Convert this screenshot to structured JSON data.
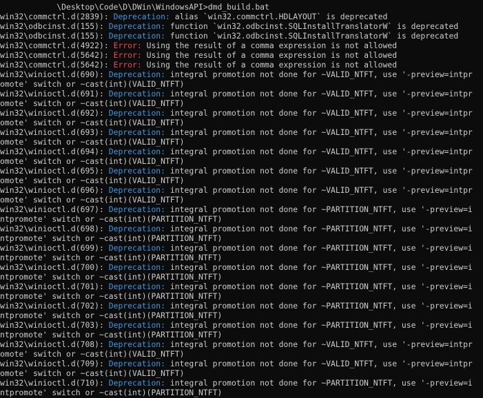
{
  "terminal": {
    "colors": {
      "background": "#0c0c0c",
      "default": "#cccccc",
      "info": "#3a96dd",
      "error": "#e74856"
    },
    "lines": [
      [
        {
          "t": "            \\Desktop\\Code\\D\\DWin\\WindowsAPI>dmd_build.bat",
          "c": "default"
        }
      ],
      [
        {
          "t": "win32\\commctrl.d(2839): ",
          "c": "default"
        },
        {
          "t": "Deprecation:",
          "c": "info"
        },
        {
          "t": " alias `win32.commctrl.HDLAYOUT` is deprecated",
          "c": "default"
        }
      ],
      [
        {
          "t": "win32\\odbcinst.d(155): ",
          "c": "default"
        },
        {
          "t": "Deprecation:",
          "c": "info"
        },
        {
          "t": " function `win32.odbcinst.SQLInstallTranslatorW` is deprecated",
          "c": "default"
        }
      ],
      [
        {
          "t": "win32\\odbcinst.d(155): ",
          "c": "default"
        },
        {
          "t": "Deprecation:",
          "c": "info"
        },
        {
          "t": " function `win32.odbcinst.SQLInstallTranslatorW` is deprecated",
          "c": "default"
        }
      ],
      [
        {
          "t": "win32\\commctrl.d(4922): ",
          "c": "default"
        },
        {
          "t": "Error:",
          "c": "error"
        },
        {
          "t": " Using the result of a comma expression is not allowed",
          "c": "default"
        }
      ],
      [
        {
          "t": "win32\\commctrl.d(5642): ",
          "c": "default"
        },
        {
          "t": "Error:",
          "c": "error"
        },
        {
          "t": " Using the result of a comma expression is not allowed",
          "c": "default"
        }
      ],
      [
        {
          "t": "win32\\commctrl.d(5642): ",
          "c": "default"
        },
        {
          "t": "Error:",
          "c": "error"
        },
        {
          "t": " Using the result of a comma expression is not allowed",
          "c": "default"
        }
      ],
      [
        {
          "t": "win32\\winioctl.d(690): ",
          "c": "default"
        },
        {
          "t": "Deprecation:",
          "c": "info"
        },
        {
          "t": " integral promotion not done for ~VALID_NTFT, use '-preview=intpr",
          "c": "default"
        }
      ],
      [
        {
          "t": "omote' switch or ~cast(int)(VALID_NTFT)",
          "c": "default"
        }
      ],
      [
        {
          "t": "win32\\winioctl.d(691): ",
          "c": "default"
        },
        {
          "t": "Deprecation:",
          "c": "info"
        },
        {
          "t": " integral promotion not done for ~VALID_NTFT, use '-preview=intpr",
          "c": "default"
        }
      ],
      [
        {
          "t": "omote' switch or ~cast(int)(VALID_NTFT)",
          "c": "default"
        }
      ],
      [
        {
          "t": "win32\\winioctl.d(692): ",
          "c": "default"
        },
        {
          "t": "Deprecation:",
          "c": "info"
        },
        {
          "t": " integral promotion not done for ~VALID_NTFT, use '-preview=intpr",
          "c": "default"
        }
      ],
      [
        {
          "t": "omote' switch or ~cast(int)(VALID_NTFT)",
          "c": "default"
        }
      ],
      [
        {
          "t": "win32\\winioctl.d(693): ",
          "c": "default"
        },
        {
          "t": "Deprecation:",
          "c": "info"
        },
        {
          "t": " integral promotion not done for ~VALID_NTFT, use '-preview=intpr",
          "c": "default"
        }
      ],
      [
        {
          "t": "omote' switch or ~cast(int)(VALID_NTFT)",
          "c": "default"
        }
      ],
      [
        {
          "t": "win32\\winioctl.d(694): ",
          "c": "default"
        },
        {
          "t": "Deprecation:",
          "c": "info"
        },
        {
          "t": " integral promotion not done for ~VALID_NTFT, use '-preview=intpr",
          "c": "default"
        }
      ],
      [
        {
          "t": "omote' switch or ~cast(int)(VALID_NTFT)",
          "c": "default"
        }
      ],
      [
        {
          "t": "win32\\winioctl.d(695): ",
          "c": "default"
        },
        {
          "t": "Deprecation:",
          "c": "info"
        },
        {
          "t": " integral promotion not done for ~VALID_NTFT, use '-preview=intpr",
          "c": "default"
        }
      ],
      [
        {
          "t": "omote' switch or ~cast(int)(VALID_NTFT)",
          "c": "default"
        }
      ],
      [
        {
          "t": "win32\\winioctl.d(696): ",
          "c": "default"
        },
        {
          "t": "Deprecation:",
          "c": "info"
        },
        {
          "t": " integral promotion not done for ~VALID_NTFT, use '-preview=intpr",
          "c": "default"
        }
      ],
      [
        {
          "t": "omote' switch or ~cast(int)(VALID_NTFT)",
          "c": "default"
        }
      ],
      [
        {
          "t": "win32\\winioctl.d(697): ",
          "c": "default"
        },
        {
          "t": "Deprecation:",
          "c": "info"
        },
        {
          "t": " integral promotion not done for ~PARTITION_NTFT, use '-preview=i",
          "c": "default"
        }
      ],
      [
        {
          "t": "ntpromote' switch or ~cast(int)(PARTITION_NTFT)",
          "c": "default"
        }
      ],
      [
        {
          "t": "win32\\winioctl.d(698): ",
          "c": "default"
        },
        {
          "t": "Deprecation:",
          "c": "info"
        },
        {
          "t": " integral promotion not done for ~PARTITION_NTFT, use '-preview=i",
          "c": "default"
        }
      ],
      [
        {
          "t": "ntpromote' switch or ~cast(int)(PARTITION_NTFT)",
          "c": "default"
        }
      ],
      [
        {
          "t": "win32\\winioctl.d(699): ",
          "c": "default"
        },
        {
          "t": "Deprecation:",
          "c": "info"
        },
        {
          "t": " integral promotion not done for ~PARTITION_NTFT, use '-preview=i",
          "c": "default"
        }
      ],
      [
        {
          "t": "ntpromote' switch or ~cast(int)(PARTITION_NTFT)",
          "c": "default"
        }
      ],
      [
        {
          "t": "win32\\winioctl.d(700): ",
          "c": "default"
        },
        {
          "t": "Deprecation:",
          "c": "info"
        },
        {
          "t": " integral promotion not done for ~PARTITION_NTFT, use '-preview=i",
          "c": "default"
        }
      ],
      [
        {
          "t": "ntpromote' switch or ~cast(int)(PARTITION_NTFT)",
          "c": "default"
        }
      ],
      [
        {
          "t": "win32\\winioctl.d(701): ",
          "c": "default"
        },
        {
          "t": "Deprecation:",
          "c": "info"
        },
        {
          "t": " integral promotion not done for ~PARTITION_NTFT, use '-preview=i",
          "c": "default"
        }
      ],
      [
        {
          "t": "ntpromote' switch or ~cast(int)(PARTITION_NTFT)",
          "c": "default"
        }
      ],
      [
        {
          "t": "win32\\winioctl.d(702): ",
          "c": "default"
        },
        {
          "t": "Deprecation:",
          "c": "info"
        },
        {
          "t": " integral promotion not done for ~PARTITION_NTFT, use '-preview=i",
          "c": "default"
        }
      ],
      [
        {
          "t": "ntpromote' switch or ~cast(int)(PARTITION_NTFT)",
          "c": "default"
        }
      ],
      [
        {
          "t": "win32\\winioctl.d(703): ",
          "c": "default"
        },
        {
          "t": "Deprecation:",
          "c": "info"
        },
        {
          "t": " integral promotion not done for ~PARTITION_NTFT, use '-preview=i",
          "c": "default"
        }
      ],
      [
        {
          "t": "ntpromote' switch or ~cast(int)(PARTITION_NTFT)",
          "c": "default"
        }
      ],
      [
        {
          "t": "win32\\winioctl.d(708): ",
          "c": "default"
        },
        {
          "t": "Deprecation:",
          "c": "info"
        },
        {
          "t": " integral promotion not done for ~VALID_NTFT, use '-preview=intpr",
          "c": "default"
        }
      ],
      [
        {
          "t": "omote' switch or ~cast(int)(VALID_NTFT)",
          "c": "default"
        }
      ],
      [
        {
          "t": "win32\\winioctl.d(709): ",
          "c": "default"
        },
        {
          "t": "Deprecation:",
          "c": "info"
        },
        {
          "t": " integral promotion not done for ~VALID_NTFT, use '-preview=intpr",
          "c": "default"
        }
      ],
      [
        {
          "t": "omote' switch or ~cast(int)(VALID_NTFT)",
          "c": "default"
        }
      ],
      [
        {
          "t": "win32\\winioctl.d(710): ",
          "c": "default"
        },
        {
          "t": "Deprecation:",
          "c": "info"
        },
        {
          "t": " integral promotion not done for ~PARTITION_NTFT, use '-preview=i",
          "c": "default"
        }
      ],
      [
        {
          "t": "ntpromote' switch or ~cast(int)(PARTITION_NTFT)",
          "c": "default"
        }
      ]
    ]
  }
}
